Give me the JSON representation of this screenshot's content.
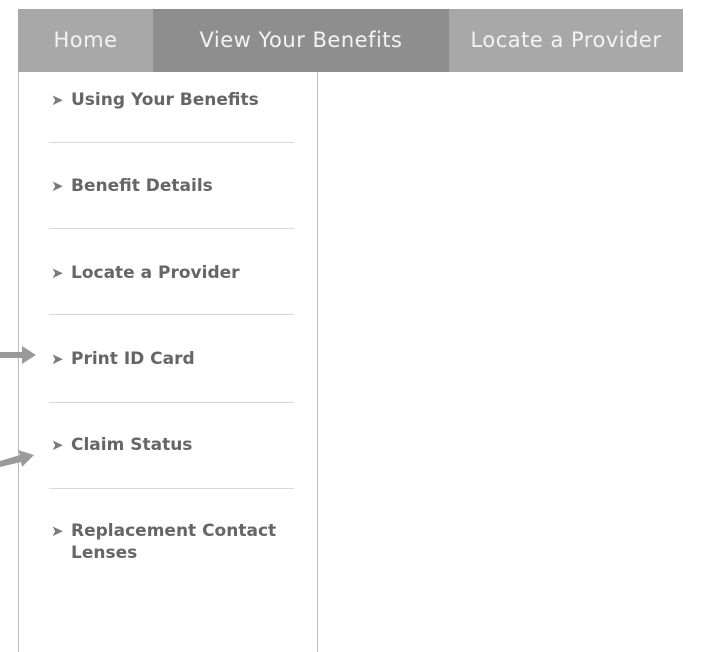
{
  "nav": {
    "tabs": [
      {
        "label": "Home"
      },
      {
        "label": "View Your Benefits"
      },
      {
        "label": "Locate a Provider"
      }
    ]
  },
  "submenu": {
    "items": [
      {
        "label": "Using Your Benefits"
      },
      {
        "label": "Benefit Details"
      },
      {
        "label": "Locate a Provider"
      },
      {
        "label": "Print ID Card"
      },
      {
        "label": "Claim Status"
      },
      {
        "label": "Replacement Contact Lenses"
      }
    ]
  },
  "colors": {
    "nav_bg": "#a8a8a8",
    "nav_active": "#8e8e8e",
    "menu_text": "#666666"
  }
}
